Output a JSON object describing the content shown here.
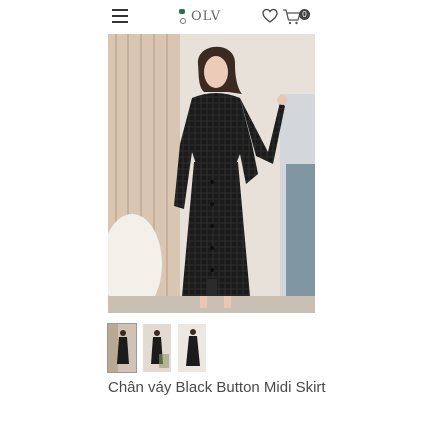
{
  "header": {
    "brand": "OLV",
    "cart_count": "0",
    "icons": [
      "menu-icon",
      "heart-icon",
      "cart-icon"
    ]
  },
  "gallery": {
    "main_image": "black-button-midi-skirt-model-photo",
    "thumbnail_count": 3,
    "active_thumbnail": 1
  },
  "product": {
    "name": "Chân váy Black Button Midi Skirt"
  },
  "colors": {
    "brand_green": "#2f6f4f",
    "text": "#4a4a4a"
  }
}
